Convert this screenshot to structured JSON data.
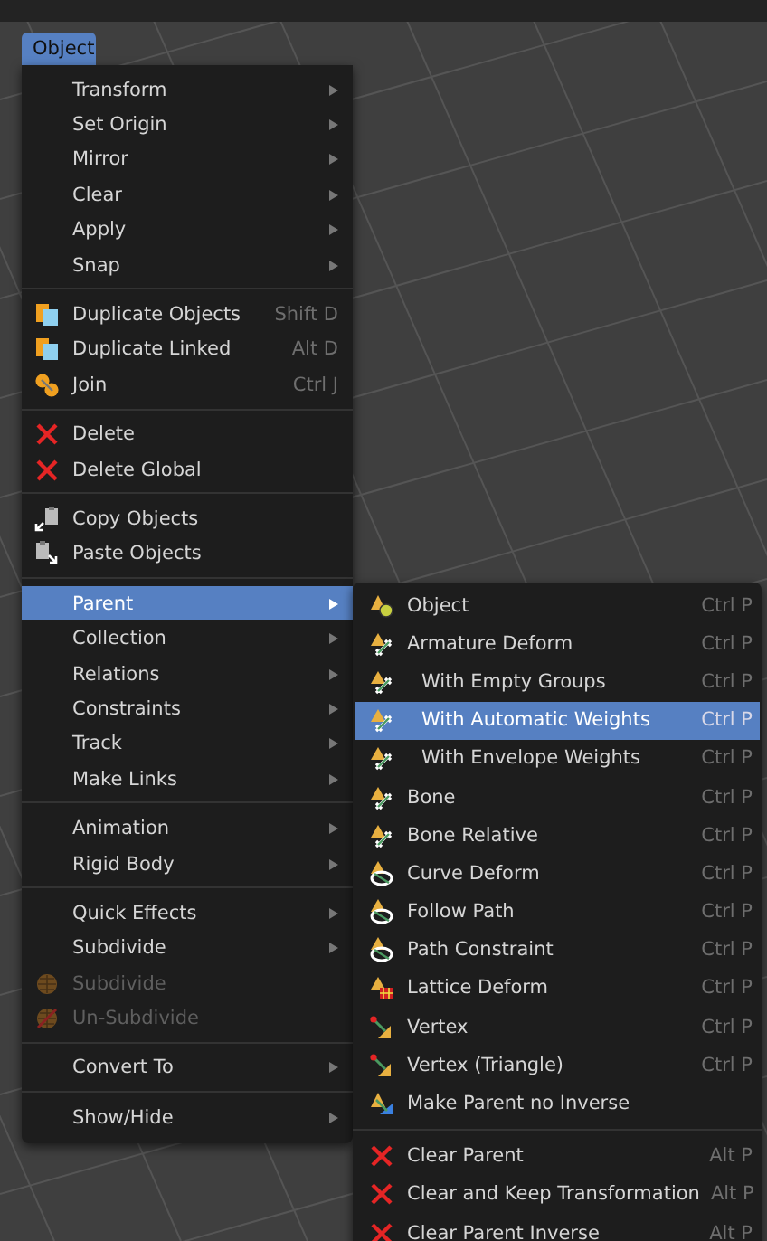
{
  "menu_bar": {
    "label": "Object",
    "selected": true
  },
  "object_menu": {
    "sections": [
      [
        {
          "label": "Transform",
          "submenu": true,
          "selected": false,
          "disabled": false
        },
        {
          "label": "Set Origin",
          "submenu": true,
          "selected": false,
          "disabled": false
        },
        {
          "label": "Mirror",
          "submenu": true,
          "selected": false,
          "disabled": false
        },
        {
          "label": "Clear",
          "submenu": true,
          "selected": false,
          "disabled": false
        },
        {
          "label": "Apply",
          "submenu": true,
          "selected": false,
          "disabled": false
        },
        {
          "label": "Snap",
          "submenu": true,
          "selected": false,
          "disabled": false
        }
      ],
      [
        {
          "label": "Duplicate Objects",
          "shortcut": "Shift D",
          "kind": "duplicate",
          "selected": false,
          "disabled": false
        },
        {
          "label": "Duplicate Linked",
          "shortcut": "Alt D",
          "kind": "duplicate",
          "selected": false,
          "disabled": false
        },
        {
          "label": "Join",
          "shortcut": "Ctrl J",
          "kind": "join",
          "selected": false,
          "disabled": false
        }
      ],
      [
        {
          "label": "Delete",
          "kind": "delete",
          "selected": false,
          "disabled": false
        },
        {
          "label": "Delete Global",
          "kind": "delete",
          "selected": false,
          "disabled": false
        }
      ],
      [
        {
          "label": "Copy Objects",
          "kind": "copy",
          "selected": false,
          "disabled": false
        },
        {
          "label": "Paste Objects",
          "kind": "paste",
          "selected": false,
          "disabled": false
        }
      ],
      [
        {
          "label": "Parent",
          "submenu": true,
          "selected": true,
          "disabled": false
        },
        {
          "label": "Collection",
          "submenu": true,
          "selected": false,
          "disabled": false
        },
        {
          "label": "Relations",
          "submenu": true,
          "selected": false,
          "disabled": false
        },
        {
          "label": "Constraints",
          "submenu": true,
          "selected": false,
          "disabled": false
        },
        {
          "label": "Track",
          "submenu": true,
          "selected": false,
          "disabled": false
        },
        {
          "label": "Make Links",
          "submenu": true,
          "selected": false,
          "disabled": false
        }
      ],
      [
        {
          "label": "Animation",
          "submenu": true,
          "selected": false,
          "disabled": false
        },
        {
          "label": "Rigid Body",
          "submenu": true,
          "selected": false,
          "disabled": false
        }
      ],
      [
        {
          "label": "Quick Effects",
          "submenu": true,
          "selected": false,
          "disabled": false
        },
        {
          "label": "Subdivide",
          "submenu": true,
          "selected": false,
          "disabled": false
        },
        {
          "label": "Subdivide",
          "kind": "subdivide",
          "selected": false,
          "disabled": true
        },
        {
          "label": "Un-Subdivide",
          "kind": "unsubdivide",
          "selected": false,
          "disabled": true
        }
      ],
      [
        {
          "label": "Convert To",
          "submenu": true,
          "selected": false,
          "disabled": false
        }
      ],
      [
        {
          "label": "Show/Hide",
          "submenu": true,
          "selected": false,
          "disabled": false
        }
      ]
    ]
  },
  "parent_menu": {
    "sections": [
      [
        {
          "label": "Object",
          "shortcut": "Ctrl P",
          "kind": "object",
          "selected": false
        },
        {
          "label": "Armature Deform",
          "shortcut": "Ctrl P",
          "kind": "armature",
          "selected": false,
          "children": [
            {
              "label": "With Empty Groups",
              "shortcut": "Ctrl P",
              "kind": "armature",
              "selected": false
            },
            {
              "label": "With Automatic Weights",
              "shortcut": "Ctrl P",
              "kind": "armature",
              "selected": true
            },
            {
              "label": "With Envelope Weights",
              "shortcut": "Ctrl P",
              "kind": "armature",
              "selected": false
            }
          ]
        },
        {
          "label": "Bone",
          "shortcut": "Ctrl P",
          "kind": "armature",
          "selected": false
        },
        {
          "label": "Bone Relative",
          "shortcut": "Ctrl P",
          "kind": "armature",
          "selected": false
        },
        {
          "label": "Curve Deform",
          "shortcut": "Ctrl P",
          "kind": "curve",
          "selected": false
        },
        {
          "label": "Follow Path",
          "shortcut": "Ctrl P",
          "kind": "curve",
          "selected": false
        },
        {
          "label": "Path Constraint",
          "shortcut": "Ctrl P",
          "kind": "curve",
          "selected": false
        },
        {
          "label": "Lattice Deform",
          "shortcut": "Ctrl P",
          "kind": "lattice",
          "selected": false
        },
        {
          "label": "Vertex",
          "shortcut": "Ctrl P",
          "kind": "vertex",
          "selected": false
        },
        {
          "label": "Vertex (Triangle)",
          "shortcut": "Ctrl P",
          "kind": "vertex",
          "selected": false
        },
        {
          "label": "Make Parent no Inverse",
          "kind": "noinverse",
          "selected": false
        }
      ],
      [
        {
          "label": "Clear Parent",
          "shortcut": "Alt P",
          "kind": "delete",
          "selected": false
        },
        {
          "label": "Clear and Keep Transformation",
          "shortcut": "Alt P",
          "kind": "delete",
          "selected": false
        },
        {
          "label": "Clear Parent Inverse",
          "shortcut": "Alt P",
          "kind": "delete",
          "selected": false
        }
      ]
    ]
  }
}
